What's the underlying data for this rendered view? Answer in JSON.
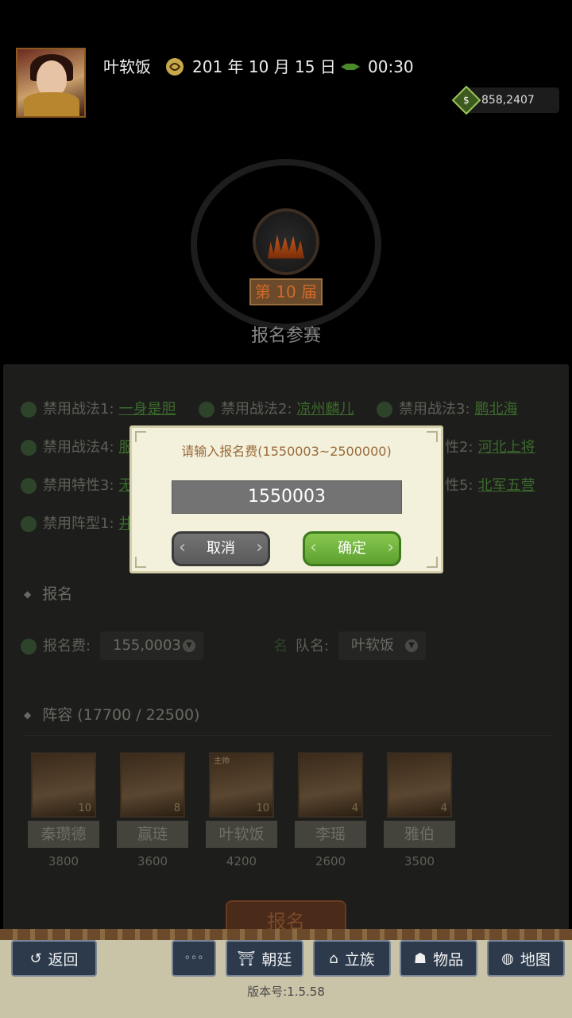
{
  "header": {
    "player_name": "叶软饭",
    "date": "201 年 10 月 15 日",
    "time": "00:30",
    "money": "858,2407"
  },
  "tournament": {
    "edition": "第 10 届",
    "title": "报名参赛"
  },
  "rules": {
    "rows": [
      {
        "label": "禁用战法1:",
        "value": "一身是胆"
      },
      {
        "label": "禁用战法2:",
        "value": "凉州麟儿"
      },
      {
        "label": "禁用战法3:",
        "value": "鹏北海"
      },
      {
        "label": "禁用战法4:",
        "value": "服"
      },
      {
        "label": "性2:",
        "value": "河北上将"
      },
      {
        "label": "禁用特性3:",
        "value": "无"
      },
      {
        "label": "性5:",
        "value": "北军五营"
      },
      {
        "label": "禁用阵型1:",
        "value": "井"
      }
    ]
  },
  "enroll_section": {
    "title": "报名",
    "fee_label": "报名费:",
    "fee_value": "155,0003",
    "team_icon": "名",
    "team_label": "队名:",
    "team_value": "叶软饭"
  },
  "lineup": {
    "title": "阵容 (17700 / 22500)",
    "heroes": [
      {
        "name": "秦瓒德",
        "value": "3800",
        "cost": "10"
      },
      {
        "name": "赢琏",
        "value": "3600",
        "cost": "8"
      },
      {
        "name": "叶软饭",
        "value": "4200",
        "cost": "10",
        "badge": "主帅"
      },
      {
        "name": "李瑶",
        "value": "2600",
        "cost": "4"
      },
      {
        "name": "雅伯",
        "value": "3500",
        "cost": "4"
      }
    ]
  },
  "enroll_button": "报名",
  "modal": {
    "prompt": "请输入报名费(1550003~2500000)",
    "input_value": "1550003",
    "cancel": "取消",
    "confirm": "确定"
  },
  "bottom_bar": {
    "back": "返回",
    "more": "◦◦◦",
    "court": "朝廷",
    "clan": "立族",
    "items": "物品",
    "map": "地图"
  },
  "version": "版本号:1.5.58",
  "colors": {
    "accent_green": "#5ea030",
    "modal_bg": "#f3f1dc",
    "bar_bg": "#2c3a4c"
  }
}
